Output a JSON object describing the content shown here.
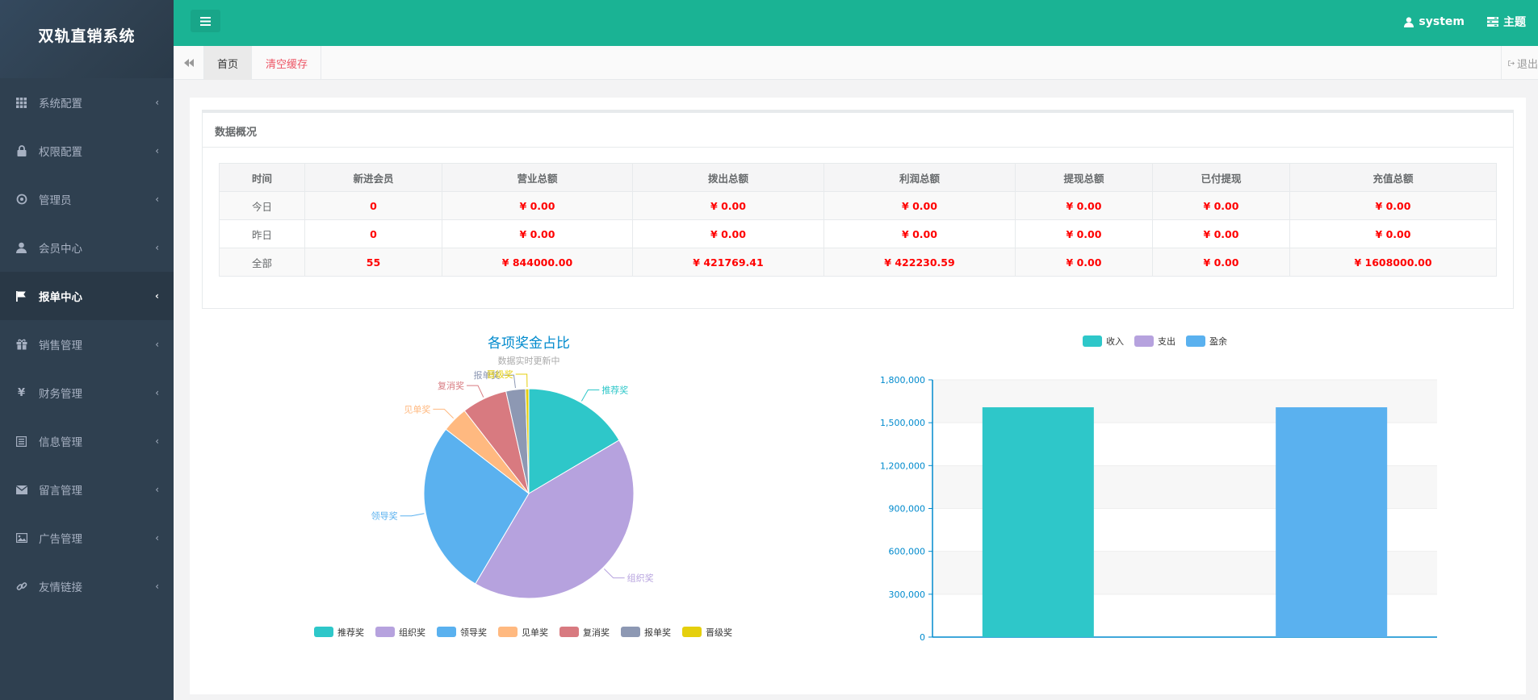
{
  "app": {
    "title": "双轨直销系统"
  },
  "sidebar": {
    "items": [
      {
        "label": "系统配置",
        "icon": "grid-icon",
        "active": false
      },
      {
        "label": "权限配置",
        "icon": "lock-icon",
        "active": false
      },
      {
        "label": "管理员",
        "icon": "target-icon",
        "active": false
      },
      {
        "label": "会员中心",
        "icon": "user-icon",
        "active": false
      },
      {
        "label": "报单中心",
        "icon": "flag-icon",
        "active": true
      },
      {
        "label": "销售管理",
        "icon": "gift-icon",
        "active": false
      },
      {
        "label": "财务管理",
        "icon": "yen-icon",
        "active": false
      },
      {
        "label": "信息管理",
        "icon": "list-icon",
        "active": false
      },
      {
        "label": "留言管理",
        "icon": "envelope-icon",
        "active": false
      },
      {
        "label": "广告管理",
        "icon": "image-icon",
        "active": false
      },
      {
        "label": "友情链接",
        "icon": "link-icon",
        "active": false
      }
    ]
  },
  "topbar": {
    "user": "system",
    "theme": "主题"
  },
  "tabs": {
    "home": "首页",
    "clear_cache": "清空缓存",
    "exit": "退出"
  },
  "overview": {
    "title": "数据概况",
    "headers": [
      "时间",
      "新进会员",
      "营业总额",
      "拨出总额",
      "利润总额",
      "提现总额",
      "已付提现",
      "充值总额"
    ],
    "rows": [
      [
        "今日",
        "0",
        "¥ 0.00",
        "¥ 0.00",
        "¥ 0.00",
        "¥ 0.00",
        "¥ 0.00",
        "¥ 0.00"
      ],
      [
        "昨日",
        "0",
        "¥ 0.00",
        "¥ 0.00",
        "¥ 0.00",
        "¥ 0.00",
        "¥ 0.00",
        "¥ 0.00"
      ],
      [
        "全部",
        "55",
        "¥ 844000.00",
        "¥ 421769.41",
        "¥ 422230.59",
        "¥ 0.00",
        "¥ 0.00",
        "¥ 1608000.00"
      ]
    ]
  },
  "colors": {
    "sidebar": "#2f4050",
    "topbar": "#1ab394",
    "value_red": "#ff0000",
    "pie": [
      "#2ec7c9",
      "#b6a2de",
      "#5ab1ef",
      "#ffb980",
      "#d87a80",
      "#8d98b3",
      "#e5cf0d"
    ]
  },
  "chart_data": [
    {
      "type": "pie",
      "title": "各项奖金占比",
      "subtitle": "数据实时更新中",
      "categories": [
        "推荐奖",
        "组织奖",
        "领导奖",
        "见单奖",
        "复消奖",
        "报单奖",
        "晋级奖"
      ],
      "values": [
        16.5,
        42,
        27,
        4,
        7,
        3,
        0.5
      ],
      "legend_position": "bottom"
    },
    {
      "type": "bar",
      "series": [
        {
          "name": "收入",
          "values": [
            1608000
          ],
          "color": "#2ec7c9"
        },
        {
          "name": "支出",
          "values": [
            0
          ],
          "color": "#b6a2de"
        },
        {
          "name": "盈余",
          "values": [
            1608000
          ],
          "color": "#5ab1ef"
        }
      ],
      "ylim": [
        0,
        1800000
      ],
      "yticks": [
        "0",
        "300,000",
        "600,000",
        "900,000",
        "1,200,000",
        "1,500,000",
        "1,800,000"
      ],
      "legend_position": "top"
    }
  ]
}
